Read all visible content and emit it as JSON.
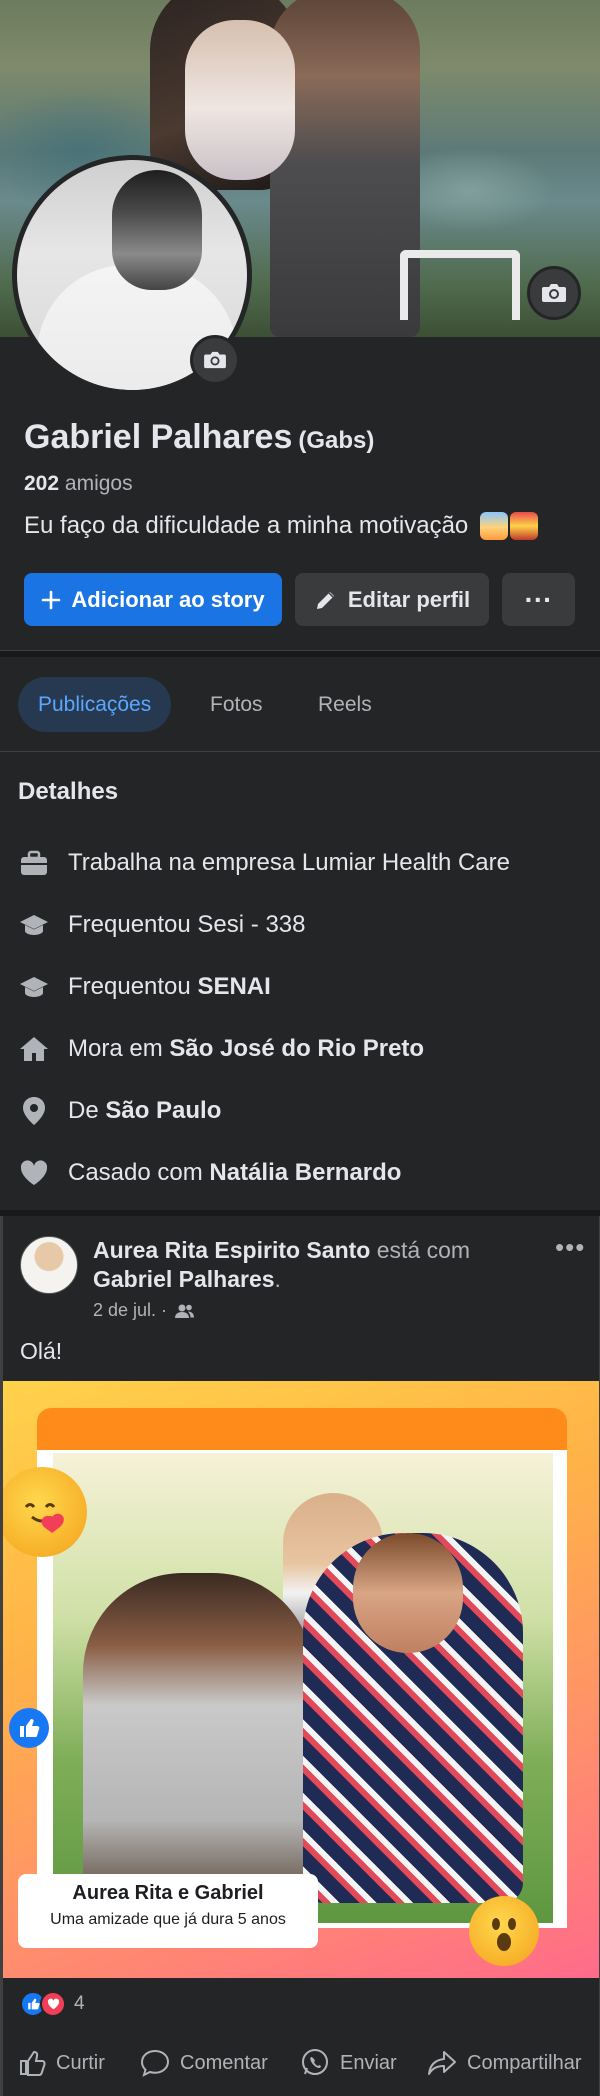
{
  "profile": {
    "name": "Gabriel Palhares",
    "nickname": "(Gabs)",
    "friends_count": "202",
    "friends_label": "amigos",
    "bio": "Eu faço da dificuldade a minha motivação"
  },
  "buttons": {
    "add_story": "Adicionar ao story",
    "edit_profile": "Editar perfil",
    "more": "···"
  },
  "tabs": [
    {
      "label": "Publicações",
      "active": true
    },
    {
      "label": "Fotos",
      "active": false
    },
    {
      "label": "Reels",
      "active": false
    }
  ],
  "details": {
    "title": "Detalhes",
    "items": [
      {
        "icon": "briefcase-icon",
        "text": "Trabalha na empresa Lumiar Health Care",
        "bold": ""
      },
      {
        "icon": "graduation-cap-icon",
        "text": "Frequentou Sesi - 338",
        "bold": ""
      },
      {
        "icon": "graduation-cap-icon",
        "text": "Frequentou ",
        "bold": "SENAI"
      },
      {
        "icon": "home-icon",
        "text": "Mora em ",
        "bold": "São José do Rio Preto"
      },
      {
        "icon": "location-pin-icon",
        "text": "De ",
        "bold": "São Paulo"
      },
      {
        "icon": "heart-icon",
        "text": "Casado com ",
        "bold": "Natália Bernardo"
      }
    ]
  },
  "post": {
    "author": "Aurea Rita Espirito Santo",
    "with_text": "está com",
    "tagged": "Gabriel Palhares",
    "date": "2 de jul. ·",
    "text": "Olá!",
    "card_title": "Aurea Rita e Gabriel",
    "card_subtitle": "Uma amizade que já dura 5 anos",
    "reaction_count": "4",
    "actions": [
      "Curtir",
      "Comentar",
      "Enviar",
      "Compartilhar"
    ]
  },
  "colors": {
    "background": "#242526",
    "primary_button": "#1b74e4",
    "active_tab_bg": "#263951",
    "active_tab_text": "#5aa7ff"
  }
}
